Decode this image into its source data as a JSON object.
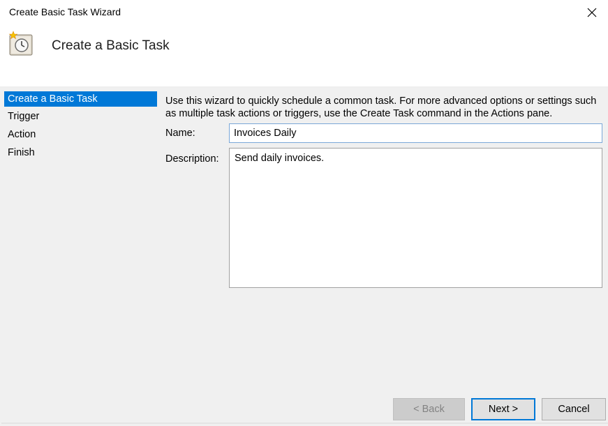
{
  "window": {
    "title": "Create Basic Task Wizard",
    "close_icon": "close-icon"
  },
  "header": {
    "title": "Create a Basic Task",
    "icon": "task-scheduler-clock-icon"
  },
  "nav": {
    "items": [
      {
        "label": "Create a Basic Task",
        "selected": true
      },
      {
        "label": "Trigger",
        "selected": false
      },
      {
        "label": "Action",
        "selected": false
      },
      {
        "label": "Finish",
        "selected": false
      }
    ]
  },
  "main": {
    "intro": "Use this wizard to quickly schedule a common task.  For more advanced options or settings such as multiple task actions or triggers, use the Create Task command in the Actions pane.",
    "name_label": "Name:",
    "name_value": "Invoices Daily",
    "description_label": "Description:",
    "description_value": "Send daily invoices."
  },
  "buttons": {
    "back": "< Back",
    "next": "Next >",
    "cancel": "Cancel"
  },
  "colors": {
    "selection": "#0078d7",
    "panel": "#f0f0f0",
    "focus_border": "#0078d7"
  }
}
